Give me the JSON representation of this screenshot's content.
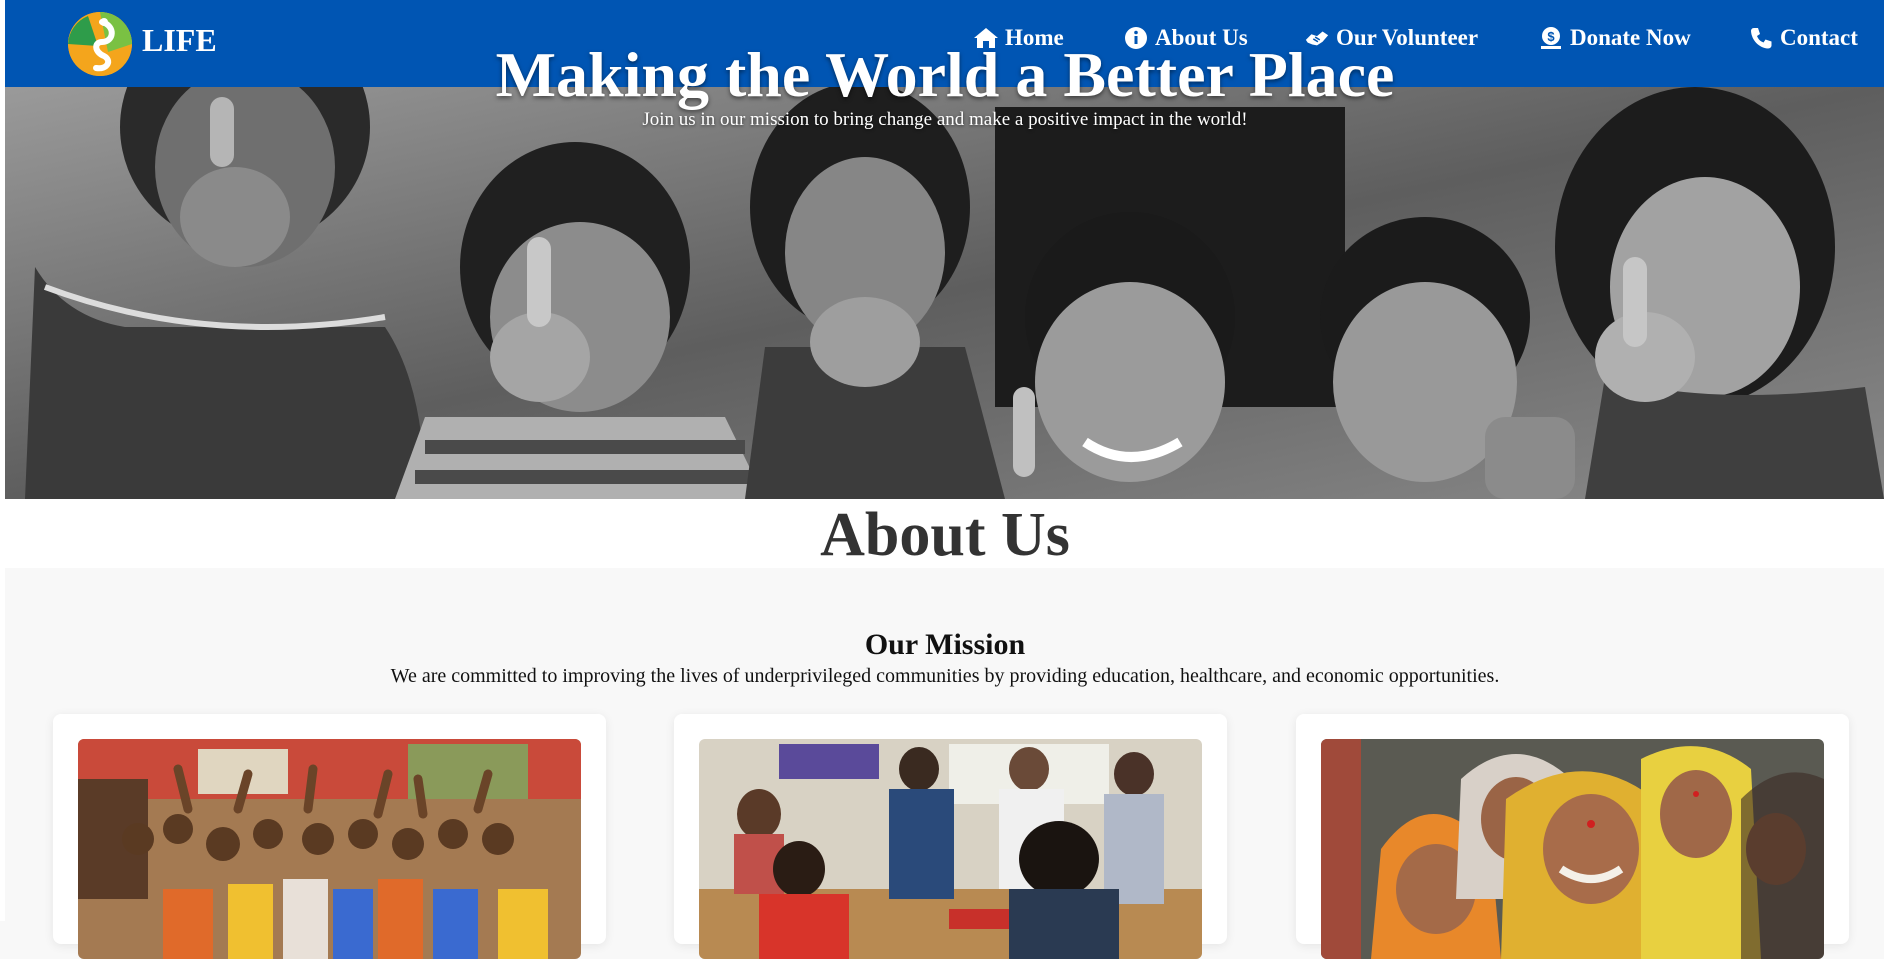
{
  "brand": {
    "name": "LIFE",
    "logo_icon": "life-logo-icon"
  },
  "nav": {
    "home": "Home",
    "about": "About Us",
    "volunteer": "Our Volunteer",
    "donate": "Donate Now",
    "contact": "Contact"
  },
  "hero": {
    "title": "Making the World a Better Place",
    "subtitle": "Join us in our mission to bring change and make a positive impact in the world!"
  },
  "about": {
    "title": "About Us",
    "mission_title": "Our Mission",
    "mission_text": "We are committed to improving the lives of underprivileged communities by providing education, healthcare, and economic opportunities."
  },
  "colors": {
    "navbar": "#0055b3",
    "page_bg": "#f8f8f8",
    "heading": "#333333"
  }
}
